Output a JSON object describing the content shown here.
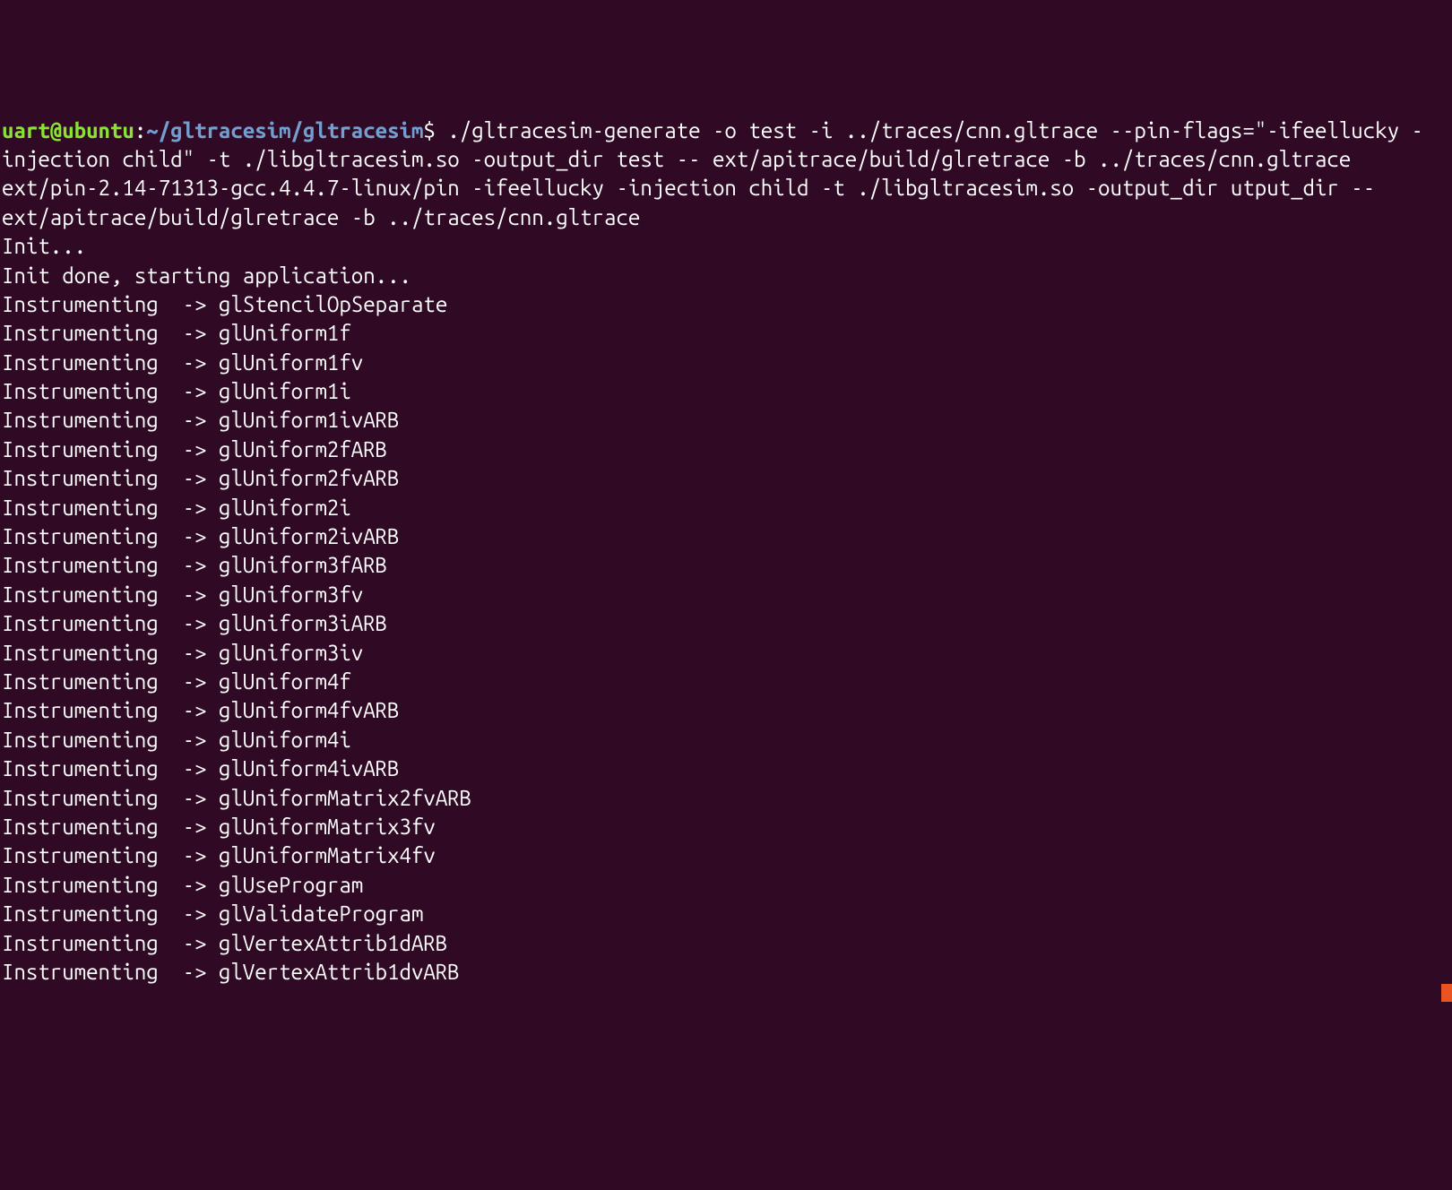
{
  "prompt": {
    "user": "uart@ubuntu",
    "separator": ":",
    "path": "~/gltracesim/gltracesim",
    "symbol": "$"
  },
  "command": " ./gltracesim-generate -o test -i ../traces/cnn.gltrace --pin-flags=\"-ifeellucky -injection child\" -t ./libgltracesim.so -output_dir test -- ext/apitrace/build/glretrace -b ../traces/cnn.gltrace",
  "output_lines": [
    "ext/pin-2.14-71313-gcc.4.4.7-linux/pin -ifeellucky -injection child -t ./libgltracesim.so -output_dir utput_dir -- ext/apitrace/build/glretrace -b ../traces/cnn.gltrace",
    "Init...",
    "Init done, starting application...",
    "Instrumenting  -> glStencilOpSeparate",
    "Instrumenting  -> glUniform1f",
    "Instrumenting  -> glUniform1fv",
    "Instrumenting  -> glUniform1i",
    "Instrumenting  -> glUniform1ivARB",
    "Instrumenting  -> glUniform2fARB",
    "Instrumenting  -> glUniform2fvARB",
    "Instrumenting  -> glUniform2i",
    "Instrumenting  -> glUniform2ivARB",
    "Instrumenting  -> glUniform3fARB",
    "Instrumenting  -> glUniform3fv",
    "Instrumenting  -> glUniform3iARB",
    "Instrumenting  -> glUniform3iv",
    "Instrumenting  -> glUniform4f",
    "Instrumenting  -> glUniform4fvARB",
    "Instrumenting  -> glUniform4i",
    "Instrumenting  -> glUniform4ivARB",
    "Instrumenting  -> glUniformMatrix2fvARB",
    "Instrumenting  -> glUniformMatrix3fv",
    "Instrumenting  -> glUniformMatrix4fv",
    "Instrumenting  -> glUseProgram",
    "Instrumenting  -> glValidateProgram",
    "Instrumenting  -> glVertexAttrib1dARB",
    "Instrumenting  -> glVertexAttrib1dvARB"
  ]
}
